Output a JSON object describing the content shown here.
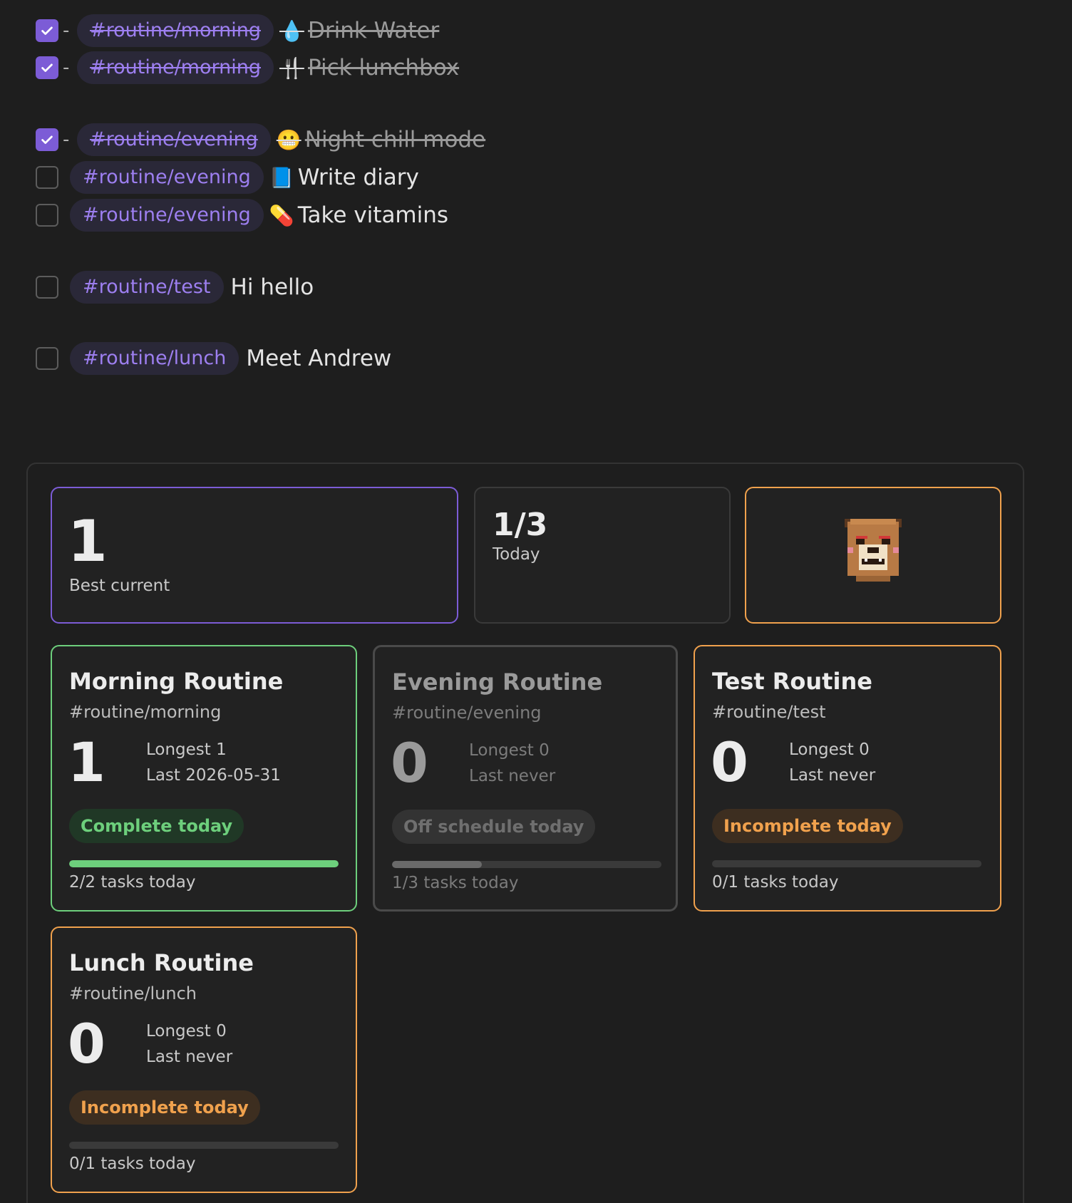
{
  "tasks": [
    {
      "tag": "#routine/morning",
      "emoji": "💧",
      "text": "Drink Water",
      "checked": true
    },
    {
      "tag": "#routine/morning",
      "emoji": "🍴",
      "text": "Pick lunchbox",
      "checked": true
    },
    {
      "tag": "#routine/evening",
      "emoji": "😬",
      "text": "Night chill mode",
      "checked": true
    },
    {
      "tag": "#routine/evening",
      "emoji": "📘",
      "text": "Write diary",
      "checked": false
    },
    {
      "tag": "#routine/evening",
      "emoji": "💊",
      "text": "Take vitamins",
      "checked": false
    },
    {
      "tag": "#routine/test",
      "emoji": "",
      "text": "Hi hello",
      "checked": false
    },
    {
      "tag": "#routine/lunch",
      "emoji": "",
      "text": "Meet Andrew",
      "checked": false
    }
  ],
  "stats": {
    "best_current": {
      "value": "1",
      "label": "Best current"
    },
    "today": {
      "value": "1/3",
      "label": "Today"
    },
    "mascot": "bear-mascot-icon"
  },
  "routines": [
    {
      "title": "Morning Routine",
      "tag": "#routine/morning",
      "streak": "1",
      "longest": "Longest 1",
      "last": "Last 2026-05-31",
      "status": "Complete today",
      "tasks_today": "2/2 tasks today",
      "progress": 1.0,
      "state": "complete"
    },
    {
      "title": "Evening Routine",
      "tag": "#routine/evening",
      "streak": "0",
      "longest": "Longest 0",
      "last": "Last never",
      "status": "Off schedule today",
      "tasks_today": "1/3 tasks today",
      "progress": 0.333,
      "state": "off"
    },
    {
      "title": "Test Routine",
      "tag": "#routine/test",
      "streak": "0",
      "longest": "Longest 0",
      "last": "Last never",
      "status": "Incomplete today",
      "tasks_today": "0/1 tasks today",
      "progress": 0,
      "state": "incomplete"
    },
    {
      "title": "Lunch Routine",
      "tag": "#routine/lunch",
      "streak": "0",
      "longest": "Longest 0",
      "last": "Last never",
      "status": "Incomplete today",
      "tasks_today": "0/1 tasks today",
      "progress": 0,
      "state": "incomplete"
    }
  ],
  "colors": {
    "accent": "#7c5cd6",
    "complete": "#6dcf7c",
    "incomplete": "#f0a14d",
    "off": "#6a6a6a"
  }
}
